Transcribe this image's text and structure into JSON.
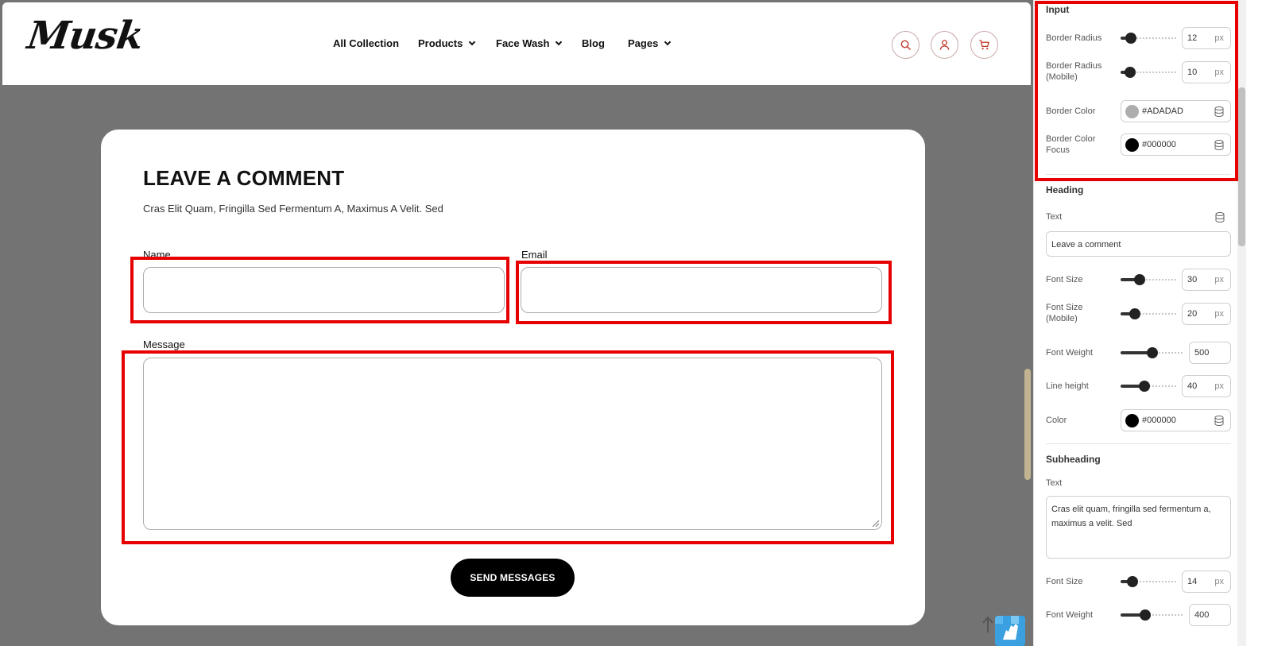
{
  "site": {
    "logo": "Musk",
    "nav": [
      {
        "label": "All Collection",
        "dropdown": false
      },
      {
        "label": "Products",
        "dropdown": true
      },
      {
        "label": "Face Wash",
        "dropdown": true
      },
      {
        "label": "Blog",
        "dropdown": false
      },
      {
        "label": "Pages",
        "dropdown": true
      }
    ],
    "icons": [
      "search-icon",
      "user-icon",
      "cart-icon"
    ],
    "accent_color": "#c0392b"
  },
  "form": {
    "heading": "LEAVE A COMMENT",
    "subheading": "Cras Elit Quam, Fringilla Sed Fermentum A, Maximus A Velit. Sed",
    "name_label": "Name",
    "name_value": "",
    "email_label": "Email",
    "email_value": "",
    "message_label": "Message",
    "message_value": "",
    "submit_label": "SEND MESSAGES",
    "highlight_color": "#e60000"
  },
  "scroll_top_label": "SCROLL TO TOP",
  "panel": {
    "input": {
      "section_title": "Input",
      "border_radius_label": "Border Radius",
      "border_radius_value": "12",
      "border_radius_unit": "px",
      "border_radius_mobile_label": "Border Radius (Mobile)",
      "border_radius_mobile_value": "10",
      "border_radius_mobile_unit": "px",
      "border_color_label": "Border Color",
      "border_color_value": "#ADADAD",
      "border_color_focus_label": "Border Color Focus",
      "border_color_focus_value": "#000000"
    },
    "heading": {
      "section_title": "Heading",
      "text_label": "Text",
      "text_value": "Leave a comment",
      "font_size_label": "Font Size",
      "font_size_value": "30",
      "font_size_unit": "px",
      "font_size_mobile_label": "Font Size (Mobile)",
      "font_size_mobile_value": "20",
      "font_size_mobile_unit": "px",
      "font_weight_label": "Font Weight",
      "font_weight_value": "500",
      "line_height_label": "Line height",
      "line_height_value": "40",
      "line_height_unit": "px",
      "color_label": "Color",
      "color_value": "#000000"
    },
    "subheading": {
      "section_title": "Subheading",
      "text_label": "Text",
      "text_value": "Cras elit quam, fringilla sed fermentum a, maximus a velit. Sed",
      "font_size_label": "Font Size",
      "font_size_value": "14",
      "font_size_unit": "px",
      "font_weight_label": "Font Weight",
      "font_weight_value": "400"
    }
  }
}
